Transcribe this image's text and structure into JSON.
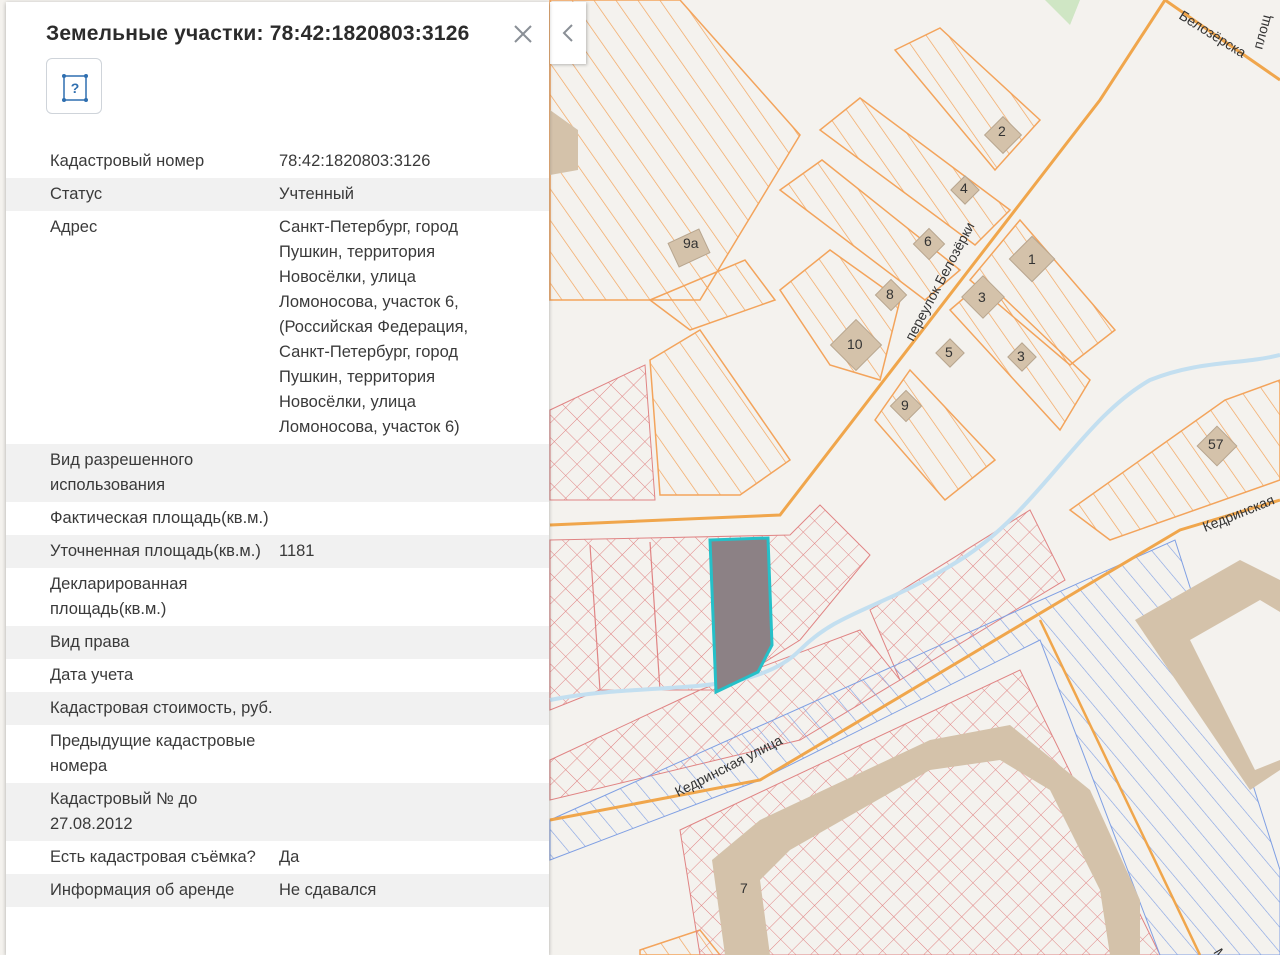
{
  "panel": {
    "title": "Земельные участки: 78:42:1820803:3126",
    "type_icon": "parcel-question-icon",
    "type_icon_glyph": "?",
    "close_icon": "close-icon",
    "properties": [
      {
        "key": "Кадастровый номер",
        "value": "78:42:1820803:3126"
      },
      {
        "key": "Статус",
        "value": "Учтенный"
      },
      {
        "key": "Адрес",
        "value": "Санкт-Петербург, город Пушкин, территория Новосёлки, улица Ломоносова, участок 6, (Российская Федерация, Санкт-Петербург, город Пушкин, территория Новосёлки, улица Ломоносова, участок 6)"
      },
      {
        "key": "Вид разрешенного использования",
        "value": ""
      },
      {
        "key": "Фактическая площадь(кв.м.)",
        "value": ""
      },
      {
        "key": "Уточненная площадь(кв.м.)",
        "value": "1181"
      },
      {
        "key": "Декларированная площадь(кв.м.)",
        "value": ""
      },
      {
        "key": "Вид права",
        "value": ""
      },
      {
        "key": "Дата учета",
        "value": ""
      },
      {
        "key": "Кадастровая стоимость, руб.",
        "value": ""
      },
      {
        "key": "Предыдущие кадастровые номера",
        "value": ""
      },
      {
        "key": "Кадастровый № до 27.08.2012",
        "value": ""
      },
      {
        "key": "Есть кадастровая съёмка?",
        "value": "Да"
      },
      {
        "key": "Информация об аренде",
        "value": "Не сдавался"
      }
    ]
  },
  "collapse_icon": "chevron-left-icon",
  "map": {
    "streets": {
      "belozerki": "переулок Белозёрки",
      "kedrinskaya": "Кедринская улица",
      "kedrinskaya_right": "Кедринская",
      "belozerskaya": "Белозёрска",
      "plosh": "площ",
      "m_partial": "М"
    },
    "house_numbers": [
      "2",
      "4",
      "6",
      "1",
      "9а",
      "8",
      "3",
      "10",
      "5",
      "3",
      "9",
      "57",
      "7"
    ],
    "colors": {
      "background": "#f4f2ee",
      "building": "#d4c2aa",
      "road": "#f0a64c",
      "parcel_orange": "#f3a45c",
      "parcel_red": "#e08484",
      "parcel_blue": "#7f9fe3",
      "water": "#c3dff0",
      "selected_fill": "#8c8185",
      "selected_stroke": "#25c0c8"
    }
  }
}
